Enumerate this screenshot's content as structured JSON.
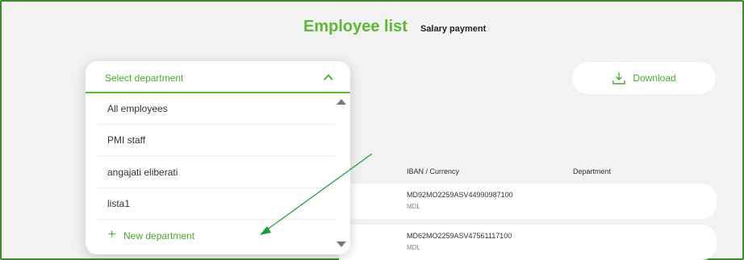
{
  "header": {
    "title": "Employee list",
    "subtitle": "Salary payment"
  },
  "download": {
    "label": "Download",
    "icon": "download-icon"
  },
  "table": {
    "columns": [
      "IBAN / Currency",
      "Department"
    ],
    "rows": [
      {
        "iban": "MD92MO2259ASV44990987100",
        "currency": "MDL",
        "department": ""
      },
      {
        "iban": "MD62MO2259ASV47561117100",
        "currency": "MDL",
        "department": ""
      }
    ]
  },
  "department_dropdown": {
    "label": "Select department",
    "options": [
      "All employees",
      "PMI staff",
      "angajati eliberati",
      "lista1"
    ],
    "new_option": "New department"
  },
  "colors": {
    "accent": "#5bb935",
    "frame": "#3f8a2e",
    "annotation_arrow": "#1a9b3c"
  }
}
